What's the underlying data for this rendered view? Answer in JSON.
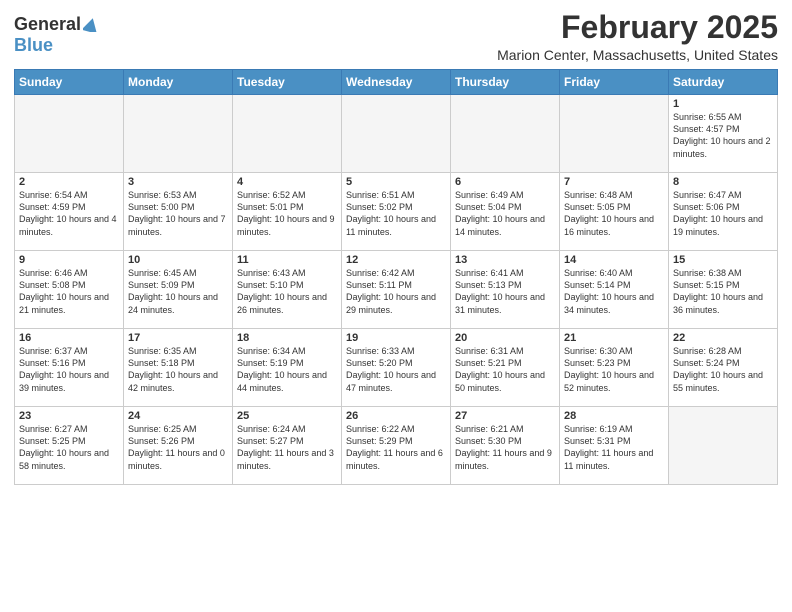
{
  "header": {
    "logo_general": "General",
    "logo_blue": "Blue",
    "month_title": "February 2025",
    "location": "Marion Center, Massachusetts, United States"
  },
  "weekdays": [
    "Sunday",
    "Monday",
    "Tuesday",
    "Wednesday",
    "Thursday",
    "Friday",
    "Saturday"
  ],
  "weeks": [
    [
      {
        "day": "",
        "info": ""
      },
      {
        "day": "",
        "info": ""
      },
      {
        "day": "",
        "info": ""
      },
      {
        "day": "",
        "info": ""
      },
      {
        "day": "",
        "info": ""
      },
      {
        "day": "",
        "info": ""
      },
      {
        "day": "1",
        "info": "Sunrise: 6:55 AM\nSunset: 4:57 PM\nDaylight: 10 hours and 2 minutes."
      }
    ],
    [
      {
        "day": "2",
        "info": "Sunrise: 6:54 AM\nSunset: 4:59 PM\nDaylight: 10 hours and 4 minutes."
      },
      {
        "day": "3",
        "info": "Sunrise: 6:53 AM\nSunset: 5:00 PM\nDaylight: 10 hours and 7 minutes."
      },
      {
        "day": "4",
        "info": "Sunrise: 6:52 AM\nSunset: 5:01 PM\nDaylight: 10 hours and 9 minutes."
      },
      {
        "day": "5",
        "info": "Sunrise: 6:51 AM\nSunset: 5:02 PM\nDaylight: 10 hours and 11 minutes."
      },
      {
        "day": "6",
        "info": "Sunrise: 6:49 AM\nSunset: 5:04 PM\nDaylight: 10 hours and 14 minutes."
      },
      {
        "day": "7",
        "info": "Sunrise: 6:48 AM\nSunset: 5:05 PM\nDaylight: 10 hours and 16 minutes."
      },
      {
        "day": "8",
        "info": "Sunrise: 6:47 AM\nSunset: 5:06 PM\nDaylight: 10 hours and 19 minutes."
      }
    ],
    [
      {
        "day": "9",
        "info": "Sunrise: 6:46 AM\nSunset: 5:08 PM\nDaylight: 10 hours and 21 minutes."
      },
      {
        "day": "10",
        "info": "Sunrise: 6:45 AM\nSunset: 5:09 PM\nDaylight: 10 hours and 24 minutes."
      },
      {
        "day": "11",
        "info": "Sunrise: 6:43 AM\nSunset: 5:10 PM\nDaylight: 10 hours and 26 minutes."
      },
      {
        "day": "12",
        "info": "Sunrise: 6:42 AM\nSunset: 5:11 PM\nDaylight: 10 hours and 29 minutes."
      },
      {
        "day": "13",
        "info": "Sunrise: 6:41 AM\nSunset: 5:13 PM\nDaylight: 10 hours and 31 minutes."
      },
      {
        "day": "14",
        "info": "Sunrise: 6:40 AM\nSunset: 5:14 PM\nDaylight: 10 hours and 34 minutes."
      },
      {
        "day": "15",
        "info": "Sunrise: 6:38 AM\nSunset: 5:15 PM\nDaylight: 10 hours and 36 minutes."
      }
    ],
    [
      {
        "day": "16",
        "info": "Sunrise: 6:37 AM\nSunset: 5:16 PM\nDaylight: 10 hours and 39 minutes."
      },
      {
        "day": "17",
        "info": "Sunrise: 6:35 AM\nSunset: 5:18 PM\nDaylight: 10 hours and 42 minutes."
      },
      {
        "day": "18",
        "info": "Sunrise: 6:34 AM\nSunset: 5:19 PM\nDaylight: 10 hours and 44 minutes."
      },
      {
        "day": "19",
        "info": "Sunrise: 6:33 AM\nSunset: 5:20 PM\nDaylight: 10 hours and 47 minutes."
      },
      {
        "day": "20",
        "info": "Sunrise: 6:31 AM\nSunset: 5:21 PM\nDaylight: 10 hours and 50 minutes."
      },
      {
        "day": "21",
        "info": "Sunrise: 6:30 AM\nSunset: 5:23 PM\nDaylight: 10 hours and 52 minutes."
      },
      {
        "day": "22",
        "info": "Sunrise: 6:28 AM\nSunset: 5:24 PM\nDaylight: 10 hours and 55 minutes."
      }
    ],
    [
      {
        "day": "23",
        "info": "Sunrise: 6:27 AM\nSunset: 5:25 PM\nDaylight: 10 hours and 58 minutes."
      },
      {
        "day": "24",
        "info": "Sunrise: 6:25 AM\nSunset: 5:26 PM\nDaylight: 11 hours and 0 minutes."
      },
      {
        "day": "25",
        "info": "Sunrise: 6:24 AM\nSunset: 5:27 PM\nDaylight: 11 hours and 3 minutes."
      },
      {
        "day": "26",
        "info": "Sunrise: 6:22 AM\nSunset: 5:29 PM\nDaylight: 11 hours and 6 minutes."
      },
      {
        "day": "27",
        "info": "Sunrise: 6:21 AM\nSunset: 5:30 PM\nDaylight: 11 hours and 9 minutes."
      },
      {
        "day": "28",
        "info": "Sunrise: 6:19 AM\nSunset: 5:31 PM\nDaylight: 11 hours and 11 minutes."
      },
      {
        "day": "",
        "info": ""
      }
    ]
  ]
}
